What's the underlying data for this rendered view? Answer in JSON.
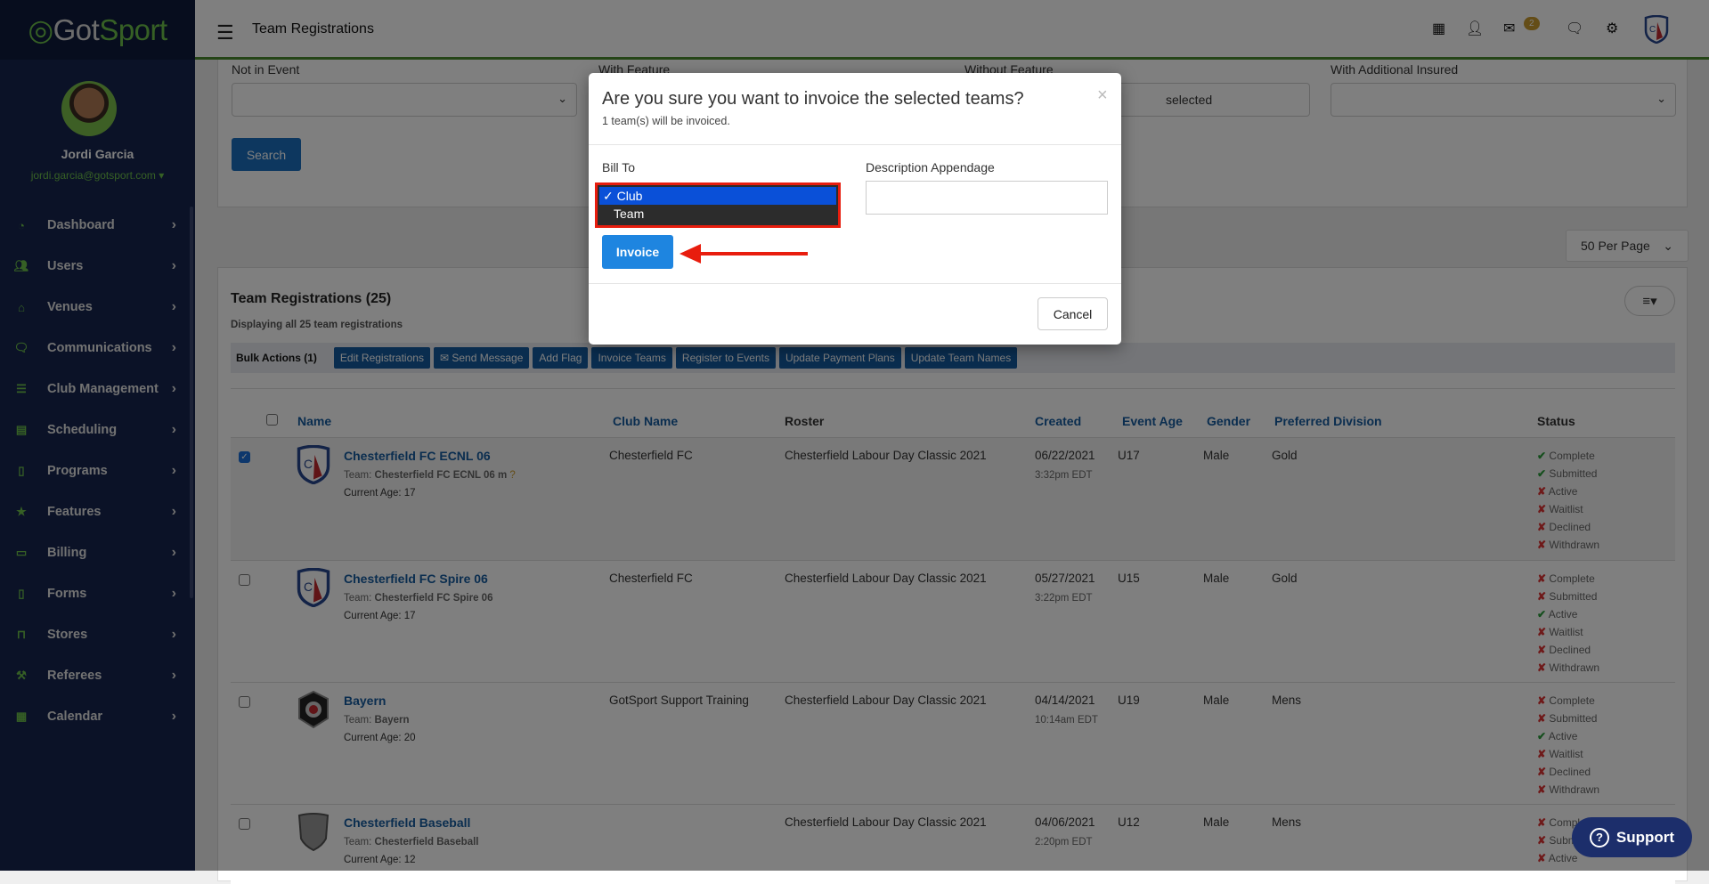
{
  "app": {
    "logo_text_1": "Got",
    "logo_text_2": "Sport",
    "brand_color": "#6cc04a"
  },
  "user": {
    "name": "Jordi Garcia",
    "email": "jordi.garcia@gotsport.com"
  },
  "sidebar": {
    "items": [
      {
        "label": "Dashboard",
        "icon": "dashboard-icon"
      },
      {
        "label": "Users",
        "icon": "users-icon"
      },
      {
        "label": "Venues",
        "icon": "home-icon"
      },
      {
        "label": "Communications",
        "icon": "chat-icon"
      },
      {
        "label": "Club Management",
        "icon": "server-icon"
      },
      {
        "label": "Scheduling",
        "icon": "list-icon"
      },
      {
        "label": "Programs",
        "icon": "file-icon"
      },
      {
        "label": "Features",
        "icon": "star-icon"
      },
      {
        "label": "Billing",
        "icon": "credit-card-icon"
      },
      {
        "label": "Forms",
        "icon": "file-blank-icon"
      },
      {
        "label": "Stores",
        "icon": "shopping-bag-icon"
      },
      {
        "label": "Referees",
        "icon": "gavel-icon"
      },
      {
        "label": "Calendar",
        "icon": "calendar-icon"
      }
    ]
  },
  "header": {
    "title": "Team Registrations",
    "mail_badge": "2"
  },
  "filters": {
    "not_in_event": "Not in Event",
    "with_feature": "With Feature",
    "without_feature": "Without Feature",
    "without_feature_value": "selected",
    "with_additional_insured": "With Additional Insured",
    "search": "Search"
  },
  "per_page": "50 Per Page",
  "table_section": {
    "title": "Team Registrations (25)",
    "subtitle": "Displaying all 25 team registrations",
    "bulk_label": "Bulk Actions (1)",
    "bulk_buttons": [
      "Edit Registrations",
      "Send Message",
      "Add Flag",
      "Invoice Teams",
      "Register to Events",
      "Update Payment Plans",
      "Update Team Names"
    ],
    "columns": [
      "Name",
      "Club Name",
      "Roster",
      "Created",
      "Event Age",
      "Gender",
      "Preferred Division",
      "Status"
    ],
    "rows": [
      {
        "name": "Chesterfield FC ECNL 06",
        "team_label": "Team:",
        "team": "Chesterfield FC ECNL 06 m",
        "age": "Current Age: 17",
        "club": "Chesterfield FC",
        "roster": "Chesterfield Labour Day Classic 2021",
        "date": "06/22/2021",
        "time": "3:32pm EDT",
        "event_age": "U17",
        "gender": "Male",
        "division": "Gold",
        "checked": true,
        "status": [
          {
            "l": "Complete",
            "ok": true
          },
          {
            "l": "Submitted",
            "ok": true
          },
          {
            "l": "Active",
            "ok": false
          },
          {
            "l": "Waitlist",
            "ok": false
          },
          {
            "l": "Declined",
            "ok": false
          },
          {
            "l": "Withdrawn",
            "ok": false
          }
        ]
      },
      {
        "name": "Chesterfield FC Spire 06",
        "team_label": "Team:",
        "team": "Chesterfield FC Spire 06",
        "age": "Current Age: 17",
        "club": "Chesterfield FC",
        "roster": "Chesterfield Labour Day Classic 2021",
        "date": "05/27/2021",
        "time": "3:22pm EDT",
        "event_age": "U15",
        "gender": "Male",
        "division": "Gold",
        "checked": false,
        "status": [
          {
            "l": "Complete",
            "ok": false
          },
          {
            "l": "Submitted",
            "ok": false
          },
          {
            "l": "Active",
            "ok": true
          },
          {
            "l": "Waitlist",
            "ok": false
          },
          {
            "l": "Declined",
            "ok": false
          },
          {
            "l": "Withdrawn",
            "ok": false
          }
        ]
      },
      {
        "name": "Bayern",
        "team_label": "Team:",
        "team": "Bayern",
        "age": "Current Age: 20",
        "club": "GotSport Support Training",
        "roster": "Chesterfield Labour Day Classic 2021",
        "date": "04/14/2021",
        "time": "10:14am EDT",
        "event_age": "U19",
        "gender": "Male",
        "division": "Mens",
        "checked": false,
        "status": [
          {
            "l": "Complete",
            "ok": false
          },
          {
            "l": "Submitted",
            "ok": false
          },
          {
            "l": "Active",
            "ok": true
          },
          {
            "l": "Waitlist",
            "ok": false
          },
          {
            "l": "Declined",
            "ok": false
          },
          {
            "l": "Withdrawn",
            "ok": false
          }
        ]
      },
      {
        "name": "Chesterfield Baseball",
        "team_label": "Team:",
        "team": "Chesterfield Baseball",
        "age": "Current Age: 12",
        "club": "",
        "roster": "Chesterfield Labour Day Classic 2021",
        "date": "04/06/2021",
        "time": "2:20pm EDT",
        "event_age": "U12",
        "gender": "Male",
        "division": "Mens",
        "checked": false,
        "status": [
          {
            "l": "Complete",
            "ok": false
          },
          {
            "l": "Submitted",
            "ok": false
          },
          {
            "l": "Active",
            "ok": false
          }
        ]
      }
    ]
  },
  "modal": {
    "title": "Are you sure you want to invoice the selected teams?",
    "subtitle": "1 team(s) will be invoiced.",
    "bill_to_label": "Bill To",
    "bill_to_options": [
      "Club",
      "Team"
    ],
    "bill_to_selected": "Club",
    "description_label": "Description Appendage",
    "description_value": "",
    "invoice": "Invoice",
    "cancel": "Cancel",
    "close": "×",
    "highlight_color": "#e81d0e"
  },
  "support": {
    "label": "Support"
  }
}
